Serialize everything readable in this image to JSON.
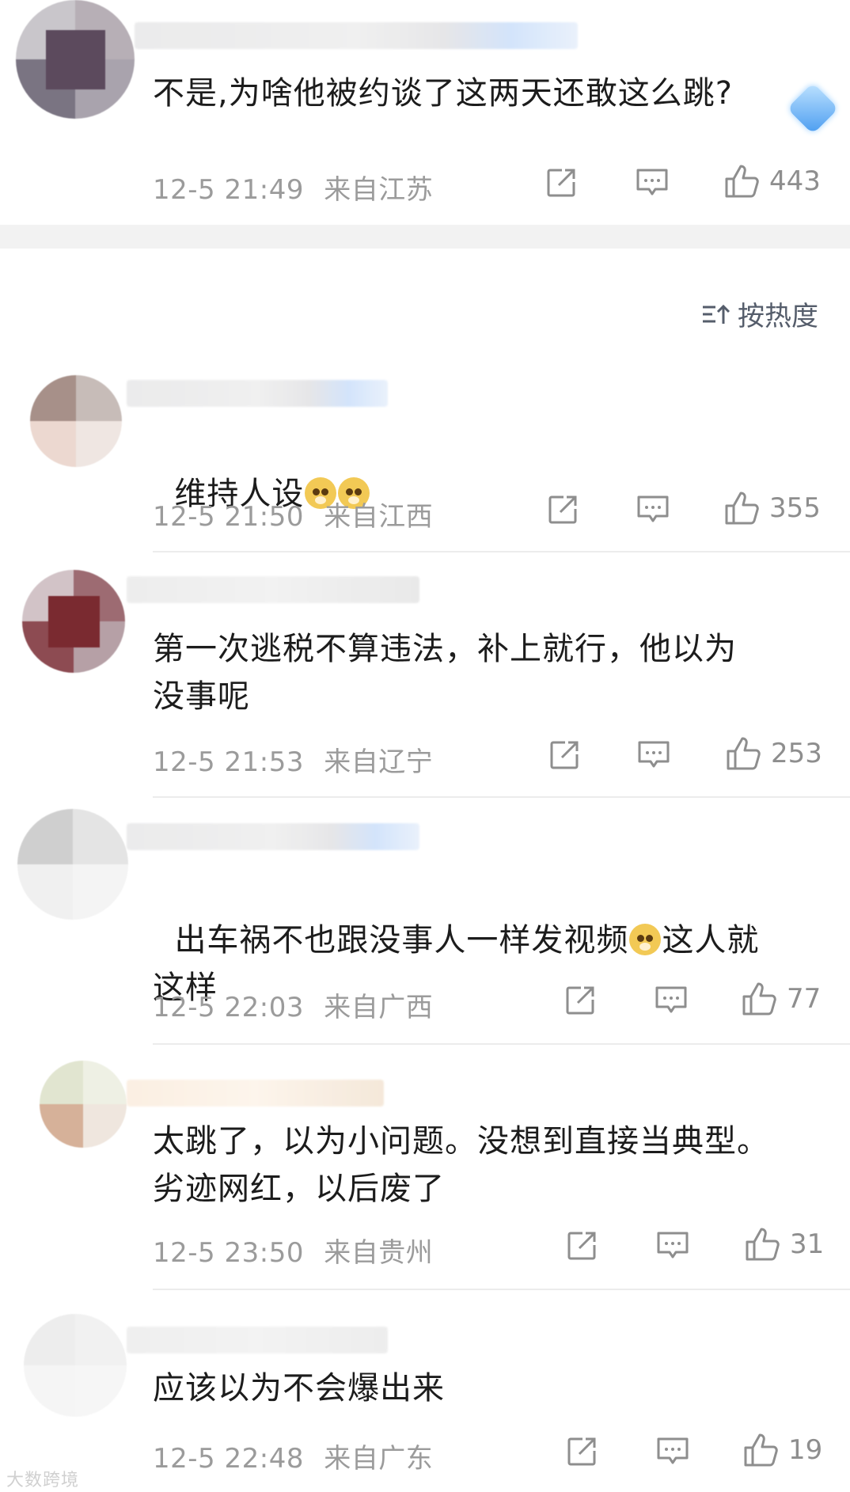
{
  "sort": {
    "label": "按热度"
  },
  "comments": [
    {
      "text": "不是,为啥他被约谈了这两天还敢这么跳?",
      "time": "12-5 21:49",
      "location": "来自江苏",
      "likes": "443"
    },
    {
      "text": "维持人设",
      "time": "12-5 21:50",
      "location": "来自江西",
      "likes": "355"
    },
    {
      "text": "第一次逃税不算违法，补上就行，他以为\n没事呢",
      "time": "12-5 21:53",
      "location": "来自辽宁",
      "likes": "253"
    },
    {
      "text_a": "出车祸不也跟没事人一样发视频",
      "text_b": "这人就\n这样",
      "time": "12-5 22:03",
      "location": "来自广西",
      "likes": "77"
    },
    {
      "text": "太跳了，以为小问题。没想到直接当典型。\n劣迹网红，以后废了",
      "time": "12-5 23:50",
      "location": "来自贵州",
      "likes": "31"
    },
    {
      "text": "应该以为不会爆出来",
      "time": "12-5 22:48",
      "location": "来自广东",
      "likes": "19"
    }
  ],
  "watermark": "大数跨境",
  "colors": {
    "meta": "#9b9b9b",
    "text": "#1c1c1c",
    "divider": "#f2f2f2",
    "accent": "#4a9cf0"
  }
}
